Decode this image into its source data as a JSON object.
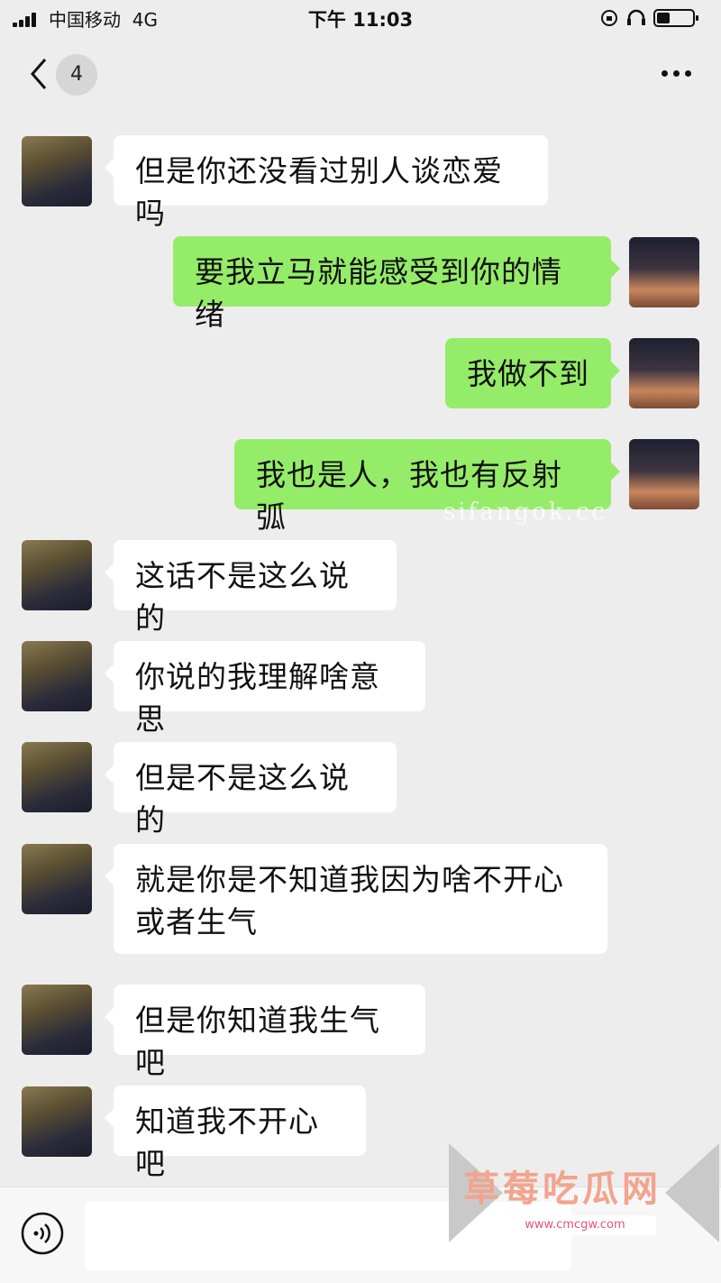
{
  "status_bar": {
    "carrier": "中国移动",
    "network": "4G",
    "time": "下午 11:03"
  },
  "nav": {
    "unread_count": "4",
    "back_icon": "chevron-left-icon",
    "more_icon": "ellipsis-icon"
  },
  "messages": [
    {
      "side": "in",
      "text": "但是你还没看过别人谈恋爱吗"
    },
    {
      "side": "out",
      "text": "要我立马就能感受到你的情绪"
    },
    {
      "side": "out",
      "text": "我做不到"
    },
    {
      "side": "out",
      "text": "我也是人，我也有反射弧"
    },
    {
      "side": "in",
      "text": "这话不是这么说的"
    },
    {
      "side": "in",
      "text": "你说的我理解啥意思"
    },
    {
      "side": "in",
      "text": "但是不是这么说的"
    },
    {
      "side": "in",
      "text": "就是你是不知道我因为啥不开心或者生气"
    },
    {
      "side": "in",
      "text": "但是你知道我生气吧"
    },
    {
      "side": "in",
      "text": "知道我不开心吧"
    }
  ],
  "watermark": "sifangok.cc",
  "overlay_logo": {
    "title": "草莓吃瓜网",
    "url": "www.cmcgw.com"
  },
  "colors": {
    "background": "#ededed",
    "incoming_bubble": "#ffffff",
    "outgoing_bubble": "#95ec69"
  }
}
